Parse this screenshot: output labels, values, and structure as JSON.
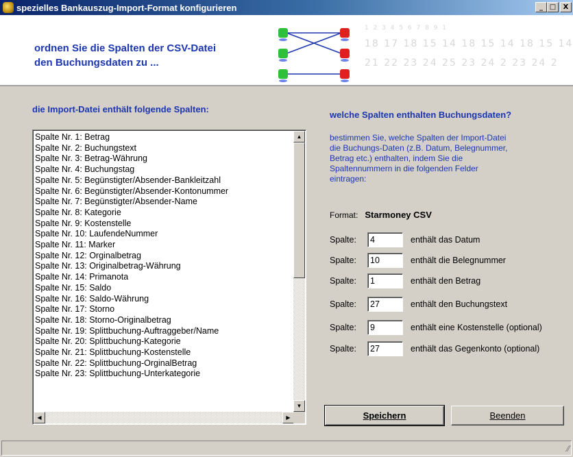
{
  "window": {
    "title": "spezielles Bankauszug-Import-Format konfigurieren",
    "minimize": "_",
    "maximize": "□",
    "close": "X"
  },
  "banner": {
    "line1": "ordnen Sie die Spalten der CSV-Datei",
    "line2": "den Buchungsdaten zu ...",
    "deco_rows": [
      "1 2 3 4 5 6 7 8 9 1",
      "18 17 18 15 14 18 15 14 18 15 14",
      "21 22 23 24 25 23 24 2 23 24 2"
    ]
  },
  "left": {
    "heading": "die Import-Datei enthält folgende Spalten:",
    "columns": [
      "Spalte Nr. 1: Betrag",
      "Spalte Nr. 2: Buchungstext",
      "Spalte Nr. 3: Betrag-Währung",
      "Spalte Nr. 4: Buchungstag",
      "Spalte Nr. 5: Begünstigter/Absender-Bankleitzahl",
      "Spalte Nr. 6: Begünstigter/Absender-Kontonummer",
      "Spalte Nr. 7: Begünstigter/Absender-Name",
      "Spalte Nr. 8: Kategorie",
      "Spalte Nr. 9: Kostenstelle",
      "Spalte Nr. 10: LaufendeNummer",
      "Spalte Nr. 11: Marker",
      "Spalte Nr. 12: Orginalbetrag",
      "Spalte Nr. 13: Originalbetrag-Währung",
      "Spalte Nr. 14: Primanota",
      "Spalte Nr. 15: Saldo",
      "Spalte Nr. 16: Saldo-Währung",
      "Spalte Nr. 17: Storno",
      "Spalte Nr. 18: Storno-Originalbetrag",
      "Spalte Nr. 19: Splittbuchung-Auftraggeber/Name",
      "Spalte Nr. 20: Splittbuchung-Kategorie",
      "Spalte Nr. 21: Splittbuchung-Kostenstelle",
      "Spalte Nr. 22: Splittbuchung-OrginalBetrag",
      "Spalte Nr. 23: Splittbuchung-Unterkategorie"
    ]
  },
  "right": {
    "heading": "welche Spalten enthalten Buchungsdaten?",
    "desc_lines": [
      "bestimmen Sie, welche Spalten der Import-Datei",
      "die Buchungs-Daten (z.B. Datum, Belegnummer,",
      "Betrag etc.) enthalten, indem Sie die",
      "Spaltennummern in die folgenden Felder",
      "eintragen:"
    ],
    "format_label": "Format:",
    "format_value": "Starmoney CSV",
    "fields": [
      {
        "label": "Spalte:",
        "value": "4",
        "desc": "enthält das Datum"
      },
      {
        "label": "Spalte:",
        "value": "10",
        "desc": "enthält die Belegnummer"
      },
      {
        "label": "Spalte:",
        "value": "1",
        "desc": "enthält den Betrag"
      },
      {
        "label": "Spalte:",
        "value": "27",
        "desc": "enthält den Buchungstext"
      },
      {
        "label": "Spalte:",
        "value": "9",
        "desc": "enthält eine Kostenstelle (optional)"
      },
      {
        "label": "Spalte:",
        "value": "27",
        "desc": "enthält das Gegenkonto (optional)"
      }
    ]
  },
  "buttons": {
    "save": "Speichern",
    "exit": "Beenden"
  },
  "status": {
    "grip": "⁄⁄"
  }
}
